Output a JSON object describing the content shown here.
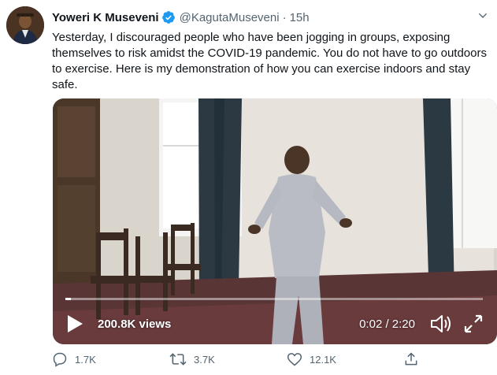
{
  "author": {
    "name": "Yoweri K Museveni",
    "handle": "@KagutaMuseveni",
    "separator": "·",
    "time": "15h"
  },
  "tweet": {
    "text": "Yesterday, I discouraged people who have been jogging in groups, exposing themselves to risk amidst the COVID-19 pandemic. You do not have to go outdoors to exercise. Here is my demonstration of how you can exercise indoors and stay safe."
  },
  "video": {
    "views": "200.8K views",
    "time": "0:02 / 2:20",
    "progress_fraction": 0.014
  },
  "actions": {
    "replies": "1.7K",
    "retweets": "3.7K",
    "likes": "12.1K"
  },
  "colors": {
    "verified": "#1d9bf0",
    "muted_text": "#536471",
    "text": "#0f1419"
  },
  "icons": {
    "verified": "verified-badge-icon",
    "more": "chevron-down-icon",
    "play": "play-icon",
    "volume": "volume-icon",
    "fullscreen": "fullscreen-icon",
    "reply": "reply-icon",
    "retweet": "retweet-icon",
    "like": "heart-icon",
    "share": "share-icon"
  }
}
